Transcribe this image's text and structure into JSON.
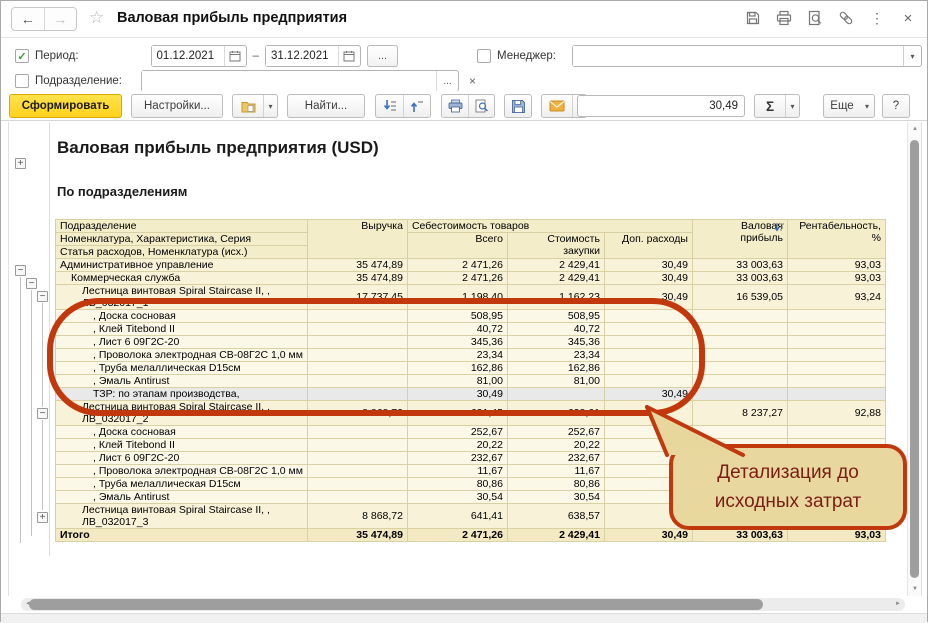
{
  "window": {
    "title": "Валовая прибыль предприятия"
  },
  "glyphs": {
    "back": "←",
    "forward": "→",
    "star": "☆",
    "kebab": "⋮",
    "close": "×",
    "ellipsis": "...",
    "dots": "...",
    "dash": "–",
    "caret": "▾",
    "check": "✓",
    "plus": "+",
    "minus": "−",
    "clear": "×",
    "up": "▲",
    "down": "▼",
    "left": "◄",
    "right": "►"
  },
  "filters": {
    "period": {
      "label": "Период:",
      "from": "01.12.2021",
      "to": "31.12.2021"
    },
    "manager": {
      "label": "Менеджер:",
      "value": ""
    },
    "department": {
      "label": "Подразделение:",
      "value": ""
    }
  },
  "toolbar": {
    "generate_label": "Сформировать",
    "settings_label": "Настройки...",
    "find_label": "Найти...",
    "autosum_value": "30,49",
    "sigma_label": "Σ",
    "more_label": "Еще",
    "help_label": "?"
  },
  "report": {
    "title": "Валовая прибыль предприятия (USD)",
    "subtitle": "По подразделениям",
    "header": {
      "name_lines": [
        "Подразделение",
        "Номенклатура, Характеристика, Серия",
        "Статья расходов, Номенклатура (исх.)"
      ],
      "revenue": "Выручка",
      "cost_group": "Себестоимость товаров",
      "cost_total": "Всего",
      "cost_purchase": "Стоимость закупки",
      "cost_extra": "Доп. расходы",
      "gross": "Валовая прибыль",
      "margin": "Рентабельность, %"
    },
    "rows": [
      {
        "type": "group1",
        "indent": 0,
        "name": "Административное управление",
        "v": [
          "35 474,89",
          "2 471,26",
          "2 429,41",
          "30,49",
          "33 003,63",
          "93,03"
        ]
      },
      {
        "type": "group2",
        "indent": 1,
        "name": "Коммерческая служба",
        "v": [
          "35 474,89",
          "2 471,26",
          "2 429,41",
          "30,49",
          "33 003,63",
          "93,03"
        ]
      },
      {
        "type": "group3",
        "indent": 2,
        "name": "Лестница винтовая Spiral Staircase II, ,",
        "name2": "ЛВ_032017_1",
        "v": [
          "17 737,45",
          "1 198,40",
          "1 162,23",
          "30,49",
          "16 539,05",
          "93,24"
        ]
      },
      {
        "type": "detail",
        "indent": 3,
        "name": ", Доска сосновая",
        "v": [
          "",
          "508,95",
          "508,95",
          "",
          "",
          ""
        ]
      },
      {
        "type": "detail",
        "indent": 3,
        "name": ", Клей Titebond II",
        "v": [
          "",
          "40,72",
          "40,72",
          "",
          "",
          ""
        ]
      },
      {
        "type": "detail",
        "indent": 3,
        "name": ", Лист 6 09Г2С-20",
        "v": [
          "",
          "345,36",
          "345,36",
          "",
          "",
          ""
        ]
      },
      {
        "type": "detail",
        "indent": 3,
        "name": ", Проволока электродная СВ-08Г2С 1,0 мм",
        "v": [
          "",
          "23,34",
          "23,34",
          "",
          "",
          ""
        ]
      },
      {
        "type": "detail",
        "indent": 3,
        "name": ", Труба мелаллическая D15см",
        "v": [
          "",
          "162,86",
          "162,86",
          "",
          "",
          ""
        ]
      },
      {
        "type": "detail",
        "indent": 3,
        "name": ", Эмаль Antirust",
        "v": [
          "",
          "81,00",
          "81,00",
          "",
          "",
          ""
        ]
      },
      {
        "type": "tzr",
        "indent": 3,
        "name": "ТЗР: по этапам производства,",
        "v": [
          "",
          "30,49",
          "",
          "30,49",
          "",
          ""
        ]
      },
      {
        "type": "group3",
        "indent": 2,
        "name": "Лестница винтовая Spiral Staircase II, ,",
        "name2": "ЛВ_032017_2",
        "v": [
          "8 868,72",
          "631,45",
          "628,61",
          "",
          "8 237,27",
          "92,88"
        ]
      },
      {
        "type": "detail",
        "indent": 3,
        "name": ", Доска сосновая",
        "v": [
          "",
          "252,67",
          "252,67",
          "",
          "",
          ""
        ]
      },
      {
        "type": "detail",
        "indent": 3,
        "name": ", Клей Titebond II",
        "v": [
          "",
          "20,22",
          "20,22",
          "",
          "",
          ""
        ]
      },
      {
        "type": "detail",
        "indent": 3,
        "name": ", Лист 6 09Г2С-20",
        "v": [
          "",
          "232,67",
          "232,67",
          "",
          "",
          ""
        ]
      },
      {
        "type": "detail",
        "indent": 3,
        "name": ", Проволока электродная СВ-08Г2С 1,0 мм",
        "v": [
          "",
          "11,67",
          "11,67",
          "",
          "",
          ""
        ]
      },
      {
        "type": "detail",
        "indent": 3,
        "name": ", Труба мелаллическая D15см",
        "v": [
          "",
          "80,86",
          "80,86",
          "",
          "",
          ""
        ]
      },
      {
        "type": "detail",
        "indent": 3,
        "name": ", Эмаль Antirust",
        "v": [
          "",
          "30,54",
          "30,54",
          "",
          "",
          ""
        ]
      },
      {
        "type": "group3",
        "indent": 2,
        "name": "Лестница винтовая Spiral Staircase II, ,",
        "name2": "ЛВ_032017_3",
        "v": [
          "8 868,72",
          "641,41",
          "638,57",
          "",
          "",
          ""
        ]
      },
      {
        "type": "total",
        "indent": 0,
        "name": "Итого",
        "v": [
          "35 474,89",
          "2 471,26",
          "2 429,41",
          "30,49",
          "33 003,63",
          "93,03"
        ]
      }
    ]
  },
  "callout": {
    "text": "Детализация до исходных затрат"
  }
}
